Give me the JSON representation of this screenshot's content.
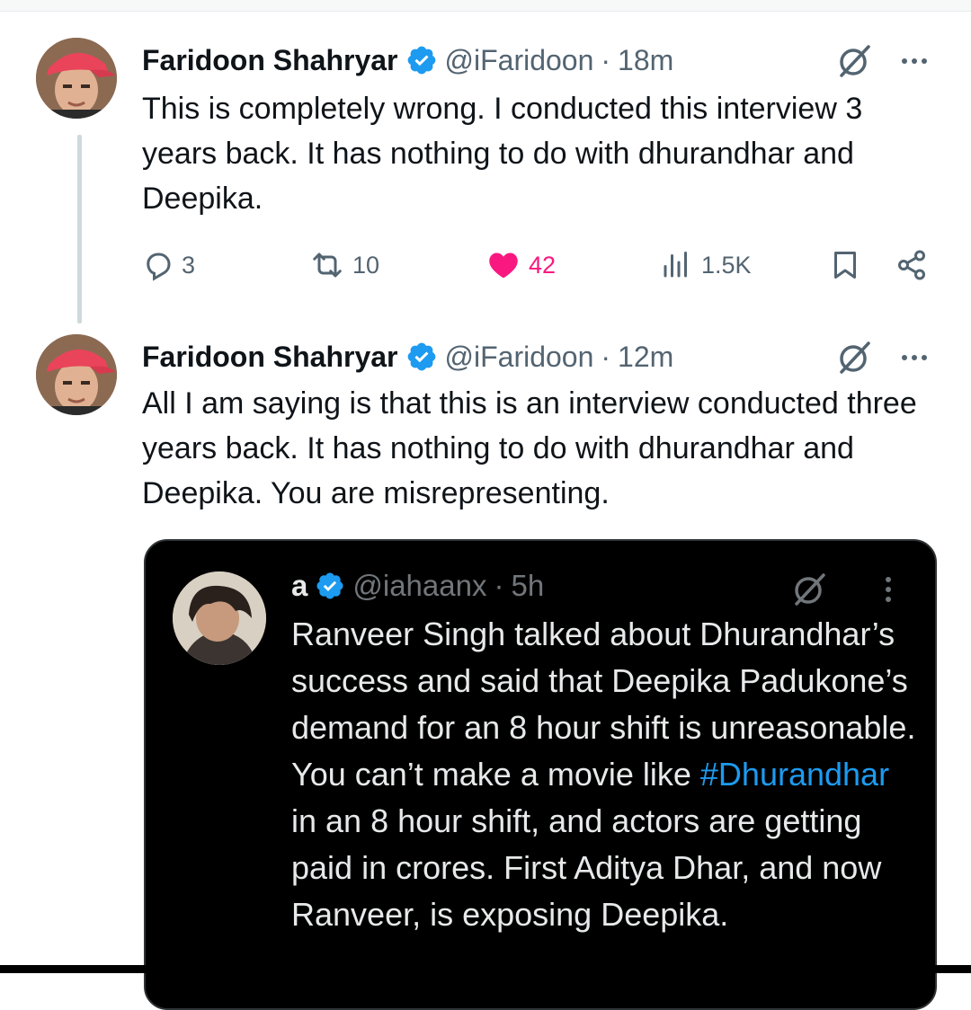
{
  "colors": {
    "verified": "#1d9bf0",
    "like": "#f91880",
    "secondary": "#536471",
    "hashtag": "#1d9bf0",
    "quote_background": "#000000"
  },
  "tweets": [
    {
      "author_name": "Faridoon Shahryar",
      "handle": "@iFaridoon",
      "separator": "·",
      "time": "18m",
      "text": "This is completely wrong. I conducted this interview 3 years back. It has nothing to do with dhurandhar and Deepika.",
      "replies": "3",
      "reposts": "10",
      "likes": "42",
      "views": "1.5K",
      "icons": [
        "verified-badge-icon",
        "grok-icon",
        "more-icon",
        "reply-icon",
        "repost-icon",
        "heart-icon",
        "views-icon",
        "bookmark-icon",
        "share-icon"
      ]
    },
    {
      "author_name": "Faridoon Shahryar",
      "handle": "@iFaridoon",
      "separator": "·",
      "time": "12m",
      "text": "All I am saying is that this is an interview conducted three years back. It has nothing to do with dhurandhar and Deepika. You are misrepresenting.",
      "icons": [
        "verified-badge-icon",
        "grok-icon",
        "more-icon"
      ]
    }
  ],
  "quoted_tweet": {
    "author_name": "a",
    "handle": "@iahaanx",
    "separator": "·",
    "time": "5h",
    "text_before": "Ranveer Singh talked about Dhurandhar’s success and said that Deepika Padukone’s demand for an 8 hour shift is unreasonable. You can’t make a movie like ",
    "hashtag": "#Dhurandhar",
    "text_after": " in an 8 hour shift, and actors are getting paid in crores. First Aditya Dhar, and now Ranveer, is exposing Deepika.",
    "icons": [
      "verified-badge-icon",
      "grok-icon",
      "vertical-more-icon"
    ]
  }
}
